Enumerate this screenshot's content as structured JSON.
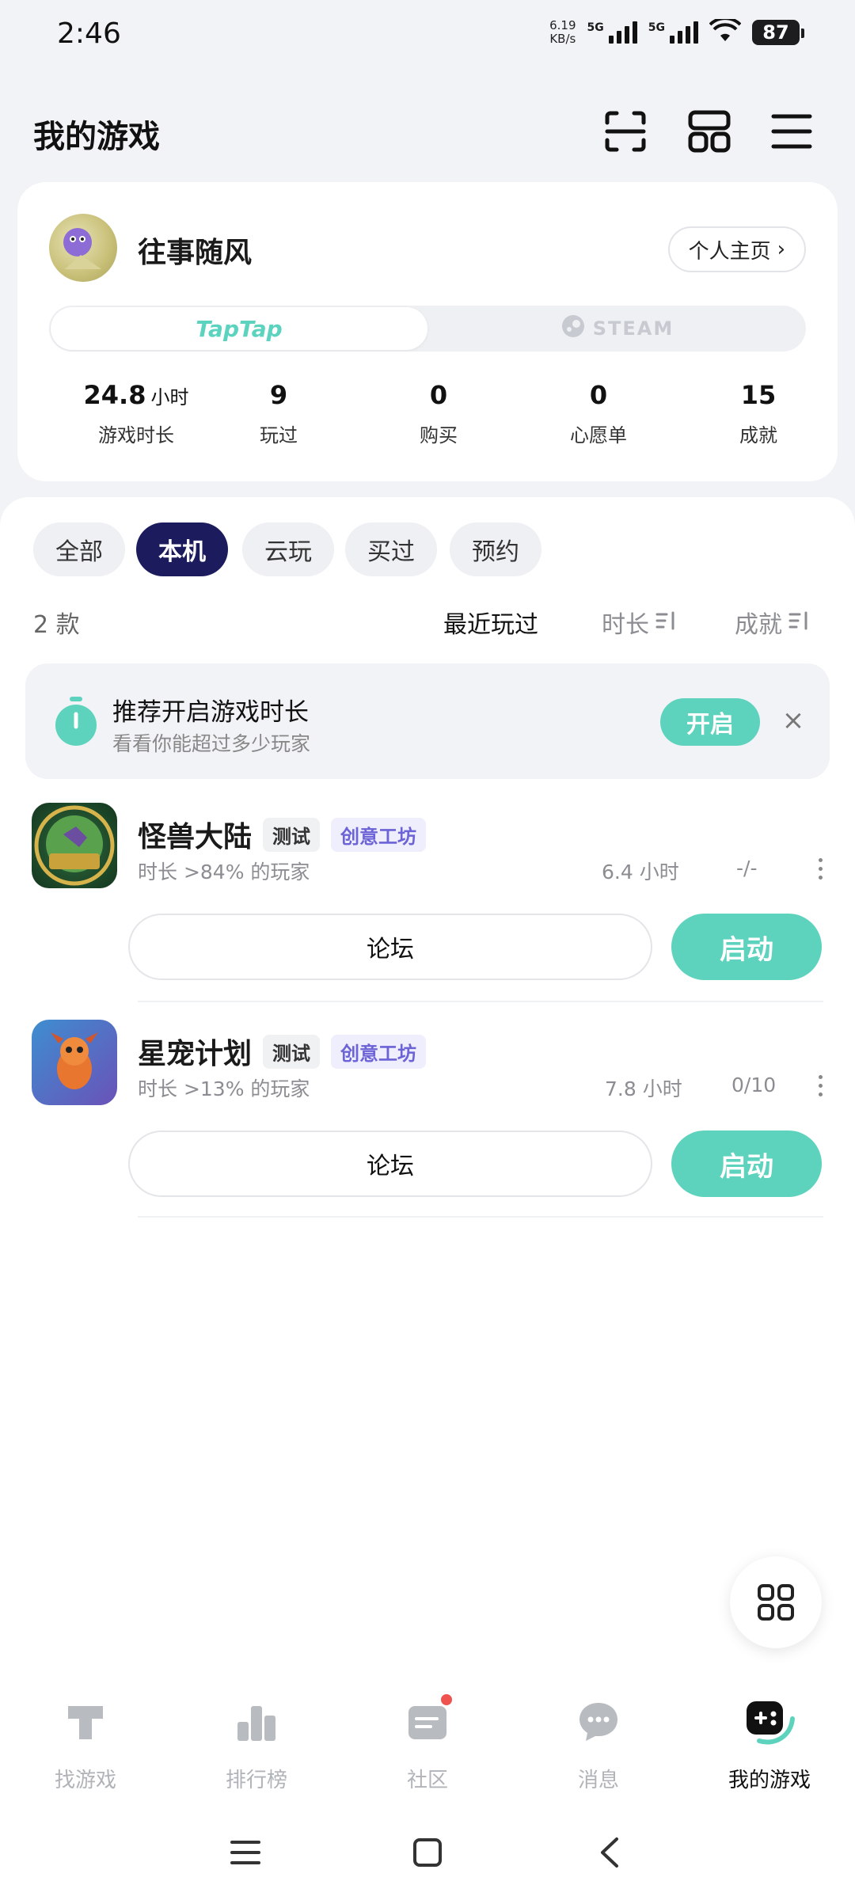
{
  "status_bar": {
    "time": "2:46",
    "net_speed_value": "6.19",
    "net_speed_unit": "KB/s",
    "sim1": "5G",
    "sim2": "5G",
    "battery": "87"
  },
  "header": {
    "title": "我的游戏",
    "icons": [
      "scan-icon",
      "grid-layout-icon",
      "menu-icon"
    ]
  },
  "profile": {
    "username": "往事随风",
    "home_button": "个人主页",
    "platforms": {
      "taptap": "TapTap",
      "steam": "STEAM",
      "selected": "TapTap"
    },
    "stats": [
      {
        "value": "24.8",
        "unit": "小时",
        "label": "游戏时长"
      },
      {
        "value": "9",
        "unit": "",
        "label": "玩过"
      },
      {
        "value": "0",
        "unit": "",
        "label": "购买"
      },
      {
        "value": "0",
        "unit": "",
        "label": "心愿单"
      },
      {
        "value": "15",
        "unit": "",
        "label": "成就"
      }
    ]
  },
  "filters": {
    "chips": [
      "全部",
      "本机",
      "云玩",
      "买过",
      "预约"
    ],
    "active": "本机"
  },
  "list_header": {
    "count": "2 款",
    "sort_options": [
      "最近玩过",
      "时长",
      "成就"
    ],
    "active_sort": "最近玩过"
  },
  "promo": {
    "title": "推荐开启游戏时长",
    "subtitle": "看看你能超过多少玩家",
    "button": "开启"
  },
  "games": [
    {
      "name": "怪兽大陆",
      "tags": [
        "测试",
        "创意工坊"
      ],
      "subtitle": "时长 >84% 的玩家",
      "playtime": "6.4 小时",
      "achievements": "-/-",
      "forum_label": "论坛",
      "start_label": "启动"
    },
    {
      "name": "星宠计划",
      "tags": [
        "测试",
        "创意工坊"
      ],
      "subtitle": "时长 >13% 的玩家",
      "playtime": "7.8 小时",
      "achievements": "0/10",
      "forum_label": "论坛",
      "start_label": "启动"
    }
  ],
  "bottom_nav": {
    "items": [
      "找游戏",
      "排行榜",
      "社区",
      "消息",
      "我的游戏"
    ],
    "active": "我的游戏"
  },
  "colors": {
    "accent": "#5dd3bd",
    "active_chip": "#1b1b5e",
    "workshop_tag": "#6c63d6",
    "badge_red": "#ef5350"
  }
}
